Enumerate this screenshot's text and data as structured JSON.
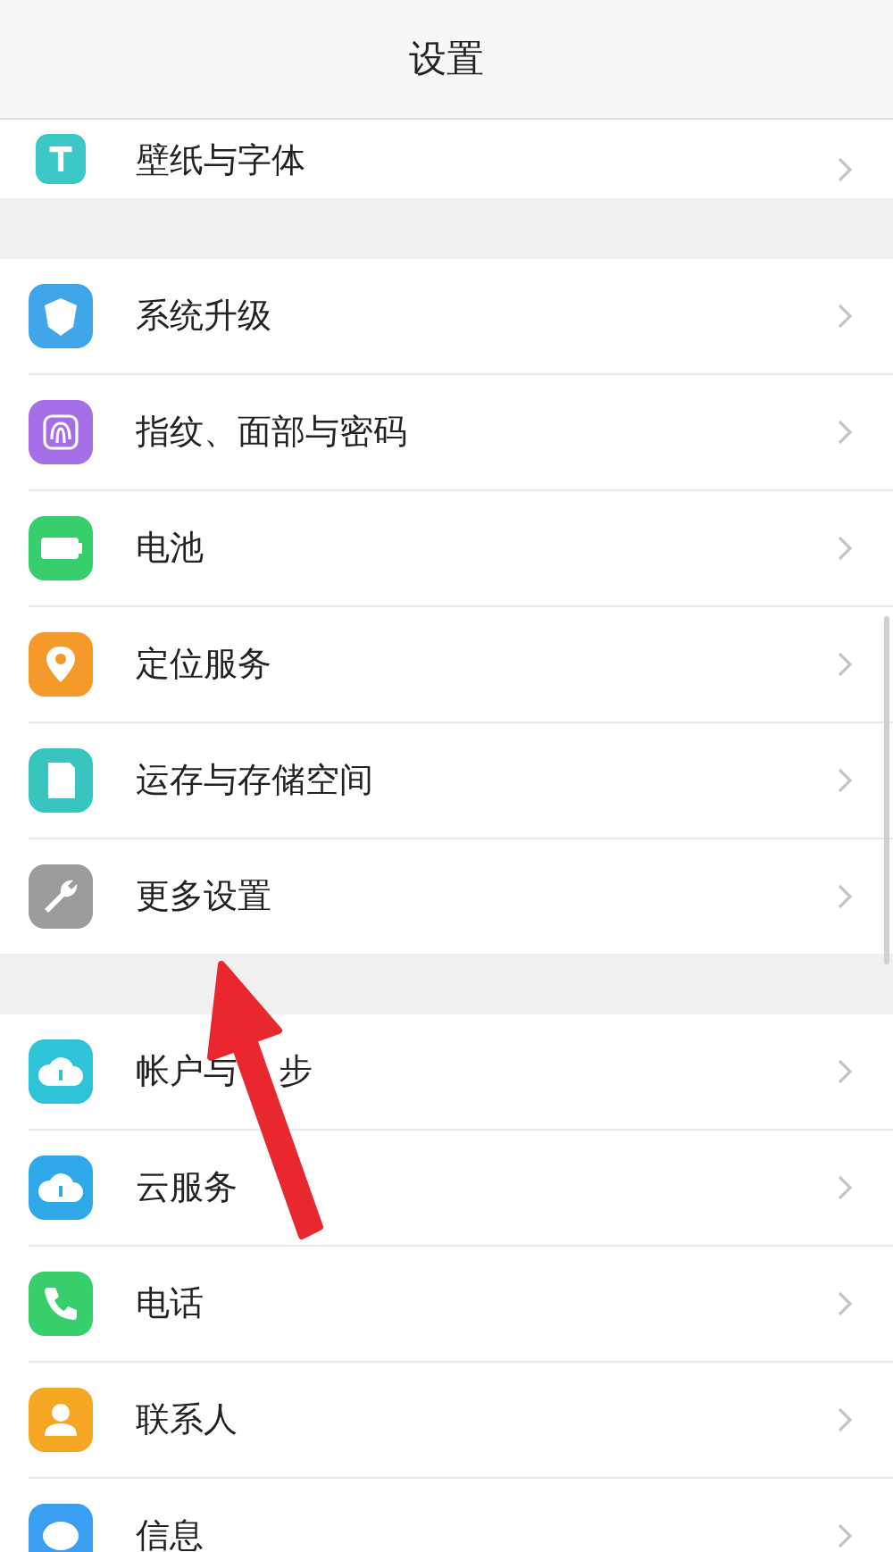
{
  "header": {
    "title": "设置"
  },
  "sections": [
    {
      "items": [
        {
          "label": "壁纸与字体",
          "kind": "wallpaper",
          "color": "#3cc8c6",
          "clipped": true
        }
      ]
    },
    {
      "items": [
        {
          "label": "系统升级",
          "kind": "shield",
          "color": "#3fa6ea"
        },
        {
          "label": "指纹、面部与密码",
          "kind": "fingerprint",
          "color": "#a56ee6"
        },
        {
          "label": "电池",
          "kind": "battery",
          "color": "#36cf6c"
        },
        {
          "label": "定位服务",
          "kind": "location",
          "color": "#f59a2a"
        },
        {
          "label": "运存与存储空间",
          "kind": "storage",
          "color": "#38c4bf"
        },
        {
          "label": "更多设置",
          "kind": "wrench",
          "color": "#9b9b9b"
        }
      ]
    },
    {
      "items": [
        {
          "label_parts": [
            "帐户与",
            "步"
          ],
          "kind": "cloud",
          "color": "#2ec3d6"
        },
        {
          "label": "云服务",
          "kind": "cloud-info",
          "color": "#2fa9ea"
        },
        {
          "label": "电话",
          "kind": "phone",
          "color": "#36cf6c"
        },
        {
          "label": "联系人",
          "kind": "contact",
          "color": "#f5a623"
        },
        {
          "label": "信息",
          "kind": "message",
          "color": "#3a9ff0"
        }
      ]
    }
  ]
}
